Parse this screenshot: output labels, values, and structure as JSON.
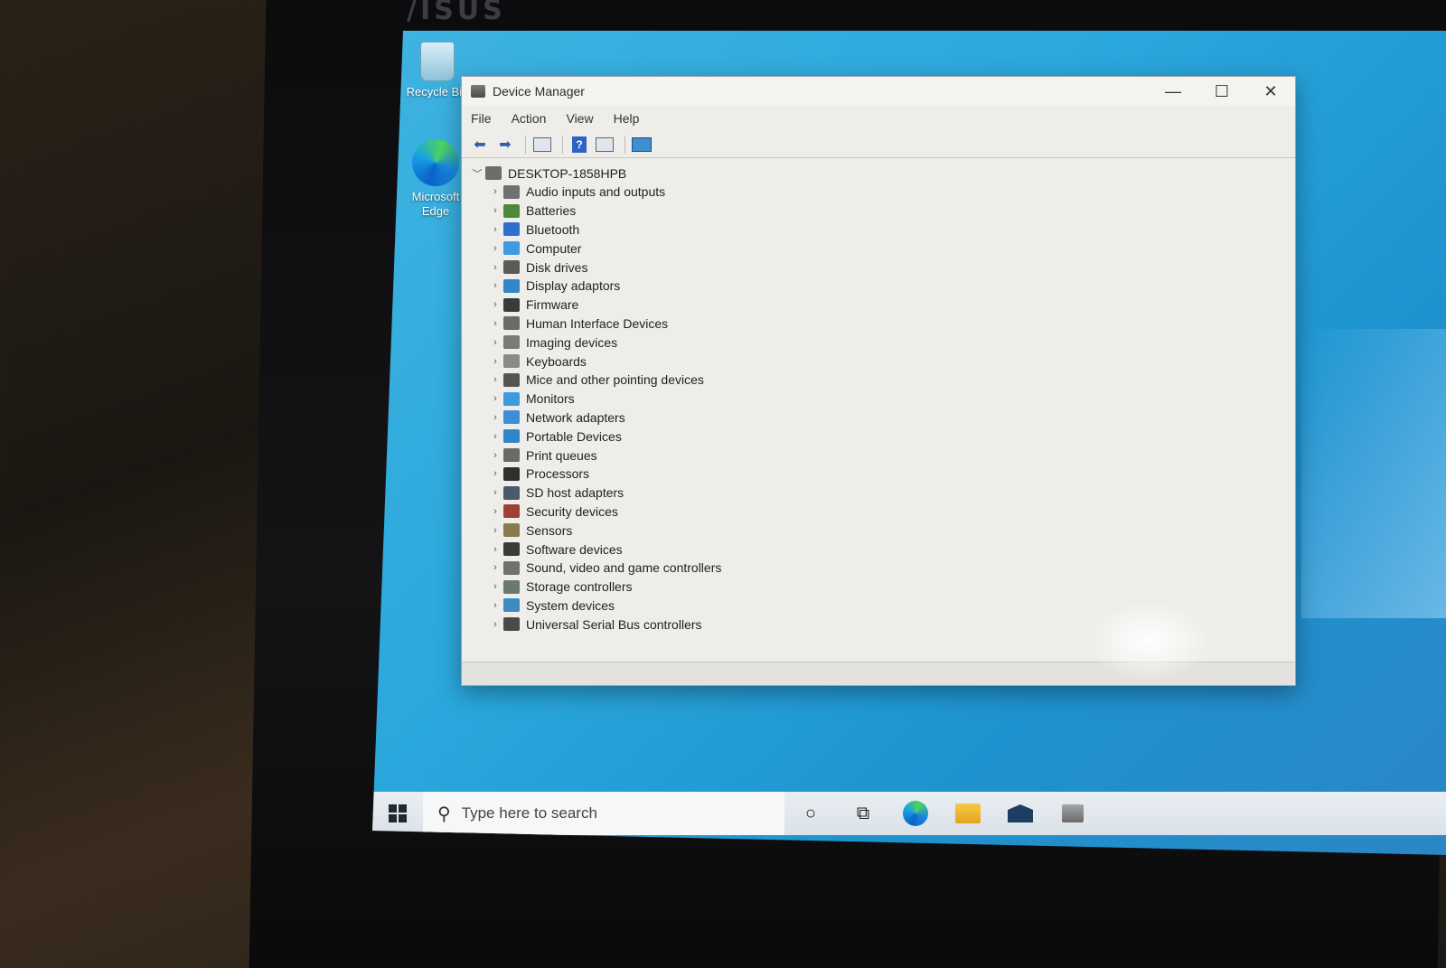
{
  "desktop": {
    "icons": [
      {
        "label": "Recycle Bin",
        "icon": "recycle-bin-icon"
      },
      {
        "label": "Microsoft Edge",
        "icon": "edge-icon"
      }
    ]
  },
  "window": {
    "title": "Device Manager",
    "controls": {
      "minimize": "—",
      "maximize": "☐",
      "close": "✕"
    },
    "menu": [
      "File",
      "Action",
      "View",
      "Help"
    ],
    "toolbar": [
      "back-icon",
      "forward-icon",
      "properties-icon",
      "help-icon",
      "view-icon",
      "monitor-icon"
    ]
  },
  "tree": {
    "root": "DESKTOP-1858HPB",
    "items": [
      {
        "label": "Audio inputs and outputs",
        "color": "#707070"
      },
      {
        "label": "Batteries",
        "color": "#4c8a3a"
      },
      {
        "label": "Bluetooth",
        "color": "#2f6fd1"
      },
      {
        "label": "Computer",
        "color": "#3d9be0"
      },
      {
        "label": "Disk drives",
        "color": "#5a5a5a"
      },
      {
        "label": "Display adaptors",
        "color": "#2f86c8"
      },
      {
        "label": "Firmware",
        "color": "#3a3a3a"
      },
      {
        "label": "Human Interface Devices",
        "color": "#6a6a6a"
      },
      {
        "label": "Imaging devices",
        "color": "#7a7a7a"
      },
      {
        "label": "Keyboards",
        "color": "#8a8a8a"
      },
      {
        "label": "Mice and other pointing devices",
        "color": "#555555"
      },
      {
        "label": "Monitors",
        "color": "#3d9be0"
      },
      {
        "label": "Network adapters",
        "color": "#3a8fd6"
      },
      {
        "label": "Portable Devices",
        "color": "#2f86c8"
      },
      {
        "label": "Print queues",
        "color": "#6a6a6a"
      },
      {
        "label": "Processors",
        "color": "#2f2f2f"
      },
      {
        "label": "SD host adapters",
        "color": "#4a5a6a"
      },
      {
        "label": "Security devices",
        "color": "#a04030"
      },
      {
        "label": "Sensors",
        "color": "#8a7a50"
      },
      {
        "label": "Software devices",
        "color": "#3a3a3a"
      },
      {
        "label": "Sound, video and game controllers",
        "color": "#707070"
      },
      {
        "label": "Storage controllers",
        "color": "#6a7a6a"
      },
      {
        "label": "System devices",
        "color": "#3d8bc6"
      },
      {
        "label": "Universal Serial Bus controllers",
        "color": "#4a4a4a"
      }
    ]
  },
  "taskbar": {
    "search_placeholder": "Type here to search",
    "apps": [
      "cortana-icon",
      "task-view-icon",
      "edge-icon",
      "file-explorer-icon",
      "mail-icon",
      "device-manager-icon"
    ]
  },
  "bezel": {
    "brand": "/ISUS"
  }
}
